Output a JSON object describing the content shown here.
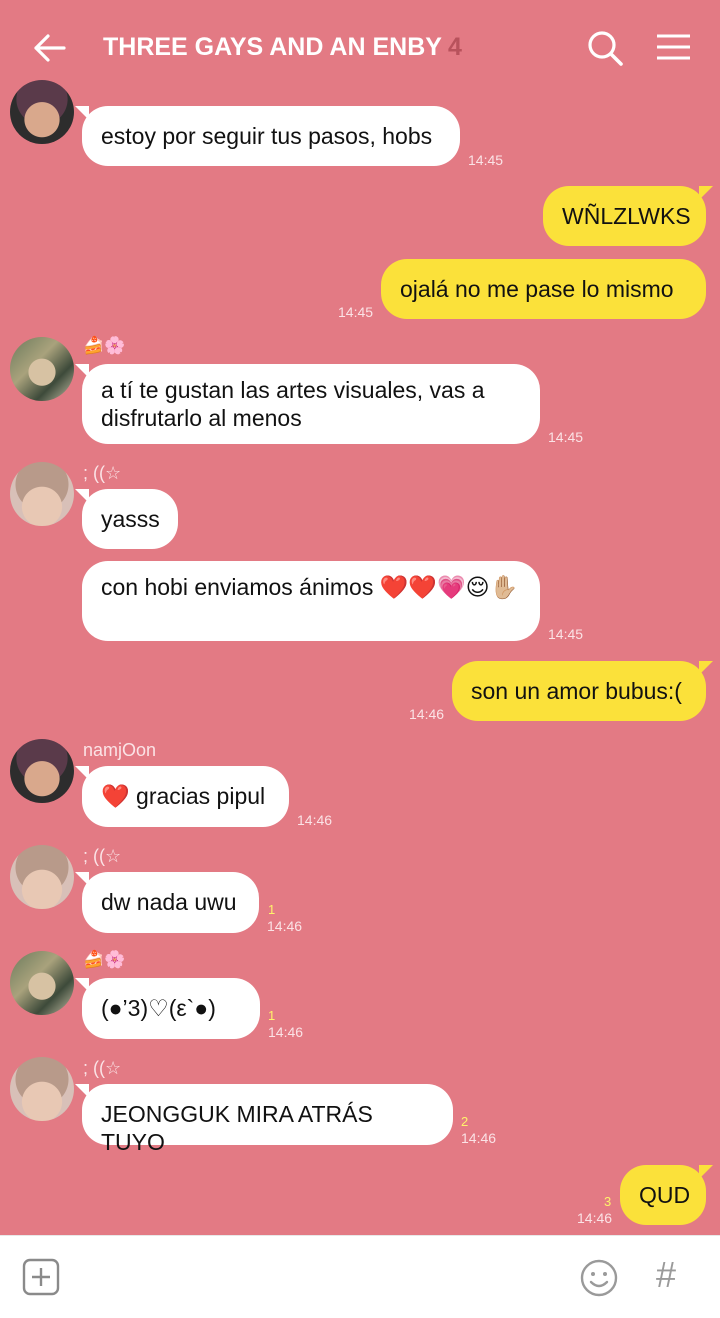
{
  "header": {
    "title": "THREE GAYS AND AN ENBY",
    "member_count": "4"
  },
  "senders": {
    "namjoon": "namjOon",
    "hoseok": "🍰🌸",
    "taehyung": "; ((☆"
  },
  "messages": [
    {
      "id": "m1",
      "text": "estoy por seguir tus pasos, hobs",
      "time": "14:45"
    },
    {
      "id": "m2",
      "text": "WÑLZLWKS",
      "time": ""
    },
    {
      "id": "m3",
      "text": "ojalá no me pase lo mismo",
      "time": "14:45"
    },
    {
      "id": "m4",
      "text": "a tí te gustan las artes visuales, vas a disfrutarlo al menos",
      "time": "14:45"
    },
    {
      "id": "m5",
      "text": "yasss",
      "time": ""
    },
    {
      "id": "m6",
      "text": "con hobi enviamos ánimos ❤️❤️💗😌✋🏼",
      "time": "14:45"
    },
    {
      "id": "m7",
      "text": "son un amor bubus:(",
      "time": "14:46"
    },
    {
      "id": "m8",
      "text": "❤️ gracias pipul",
      "time": "14:46"
    },
    {
      "id": "m9",
      "text": "dw nada uwu",
      "time": "14:46",
      "unread": "1"
    },
    {
      "id": "m10",
      "text": "(●’3)♡(ε`●)",
      "time": "14:46",
      "unread": "1"
    },
    {
      "id": "m11",
      "text": "JEONGGUK MIRA ATRÁS TUYO",
      "time": "14:46",
      "unread": "2"
    },
    {
      "id": "m12",
      "text": "QUD",
      "time": "14:46",
      "unread": "3"
    }
  ],
  "icons": {
    "back": "arrow-left-icon",
    "search": "search-icon",
    "menu": "hamburger-menu-icon",
    "attach": "plus-square-icon",
    "emoji": "smiley-icon",
    "hashtag": "hashtag-icon"
  },
  "bottom": {
    "hash_glyph": "#"
  },
  "colors": {
    "background": "#e37a84",
    "incoming_bubble": "#ffffff",
    "outgoing_bubble": "#fbe13a",
    "unread_count": "#fff36b"
  }
}
